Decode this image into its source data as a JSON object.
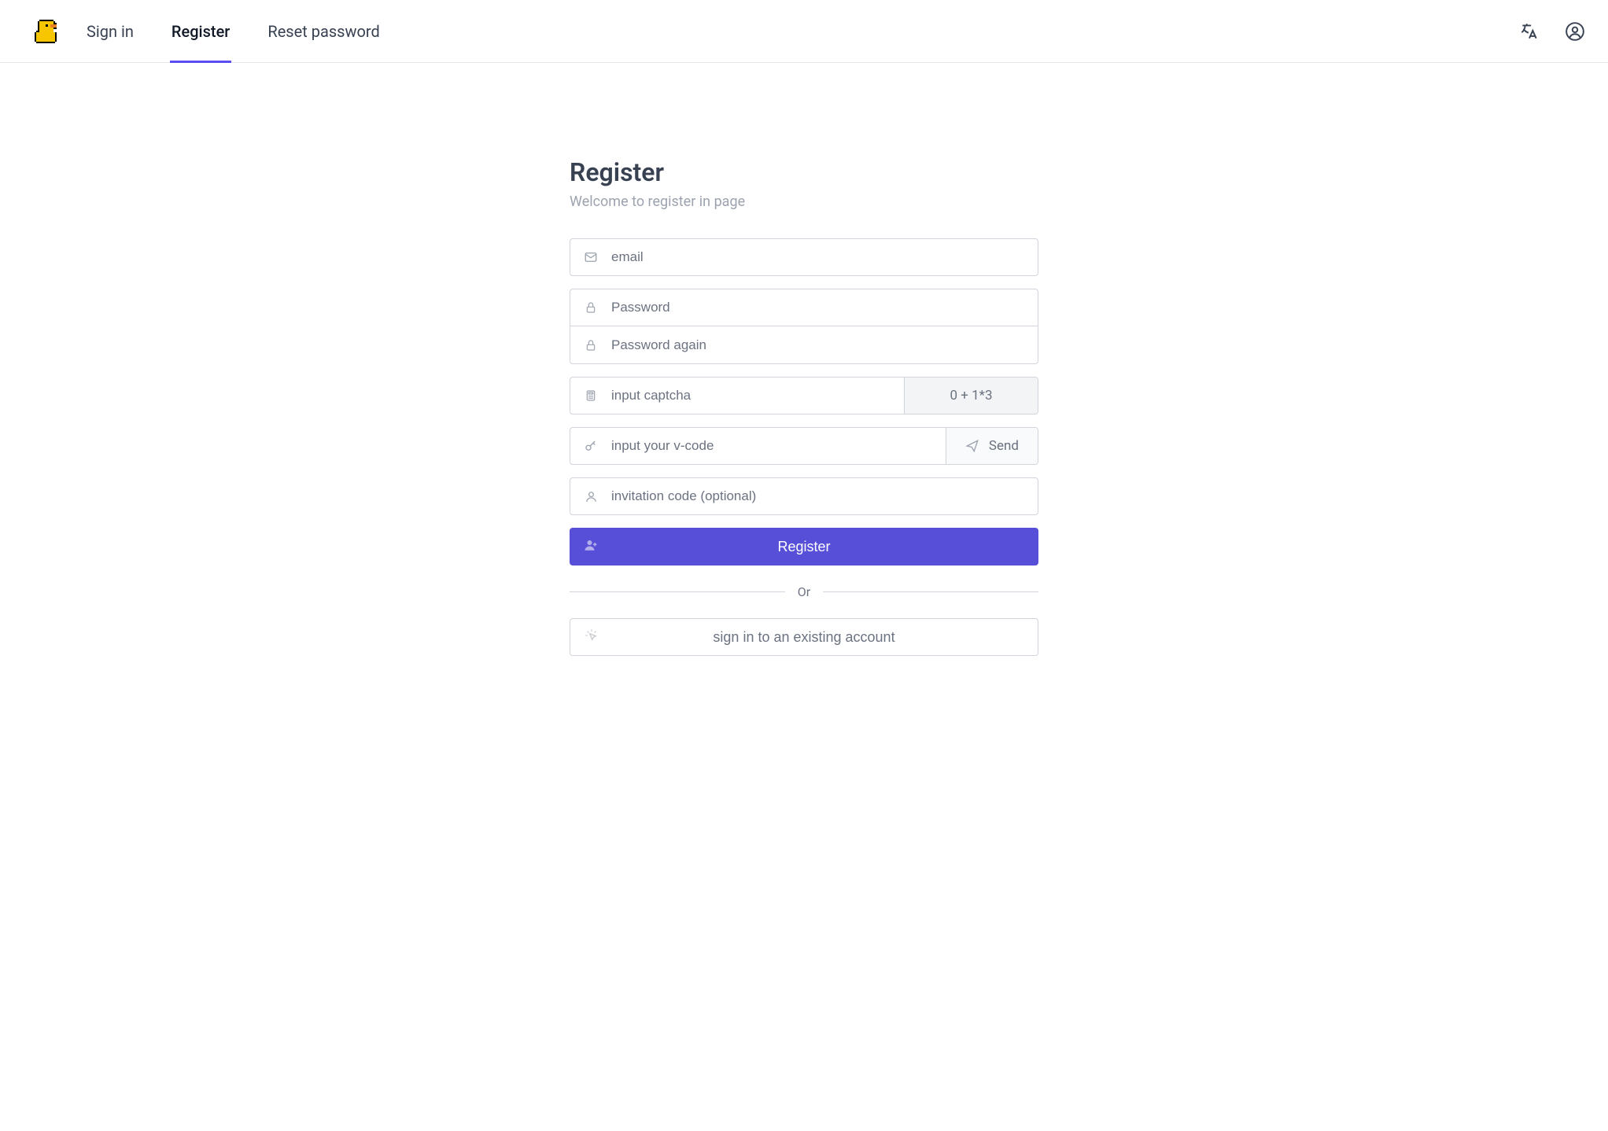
{
  "nav": {
    "tabs": [
      {
        "label": "Sign in",
        "active": false
      },
      {
        "label": "Register",
        "active": true
      },
      {
        "label": "Reset password",
        "active": false
      }
    ]
  },
  "page": {
    "title": "Register",
    "subtitle": "Welcome to register in page"
  },
  "form": {
    "email_placeholder": "email",
    "password_placeholder": "Password",
    "password2_placeholder": "Password again",
    "captcha_placeholder": "input captcha",
    "captcha_expression": "0 + 1*3",
    "vcode_placeholder": "input your v-code",
    "send_label": "Send",
    "invitation_placeholder": "invitation code (optional)",
    "register_label": "Register",
    "divider_text": "Or",
    "signin_existing_label": "sign in to an existing account"
  }
}
